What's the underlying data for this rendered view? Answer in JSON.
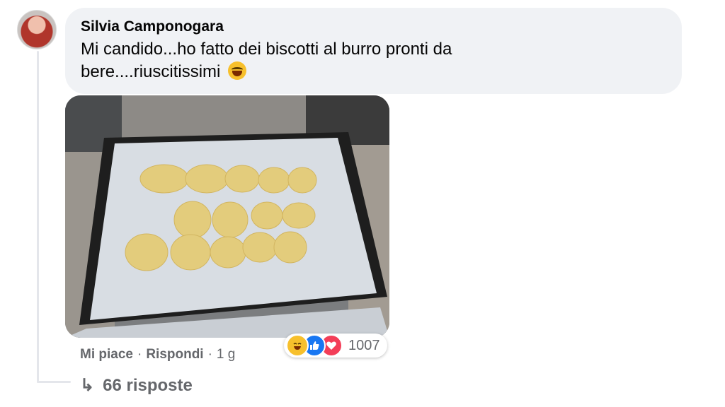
{
  "comment": {
    "author": "Silvia Camponogara",
    "text": "Mi candido...ho fatto dei biscotti al burro pronti da bere....riuscitissimi",
    "emoji": "rolling-on-floor-laughing"
  },
  "actions": {
    "like_label": "Mi piace",
    "reply_label": "Rispondi",
    "separator": "·",
    "time": "1 g"
  },
  "reactions": {
    "icons": [
      "haha-icon",
      "like-icon",
      "love-icon"
    ],
    "count": "1007",
    "colors": {
      "haha": "#f7c02c",
      "like": "#1877f2",
      "love": "#f33e58"
    }
  },
  "replies": {
    "arrow": "↳",
    "label": "66 risposte"
  }
}
